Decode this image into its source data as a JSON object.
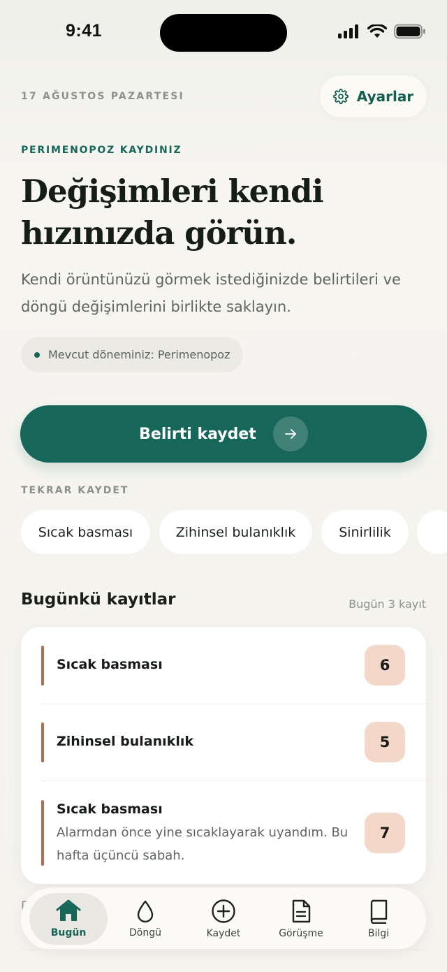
{
  "status": {
    "time": "9:41"
  },
  "header": {
    "date": "17 AĞUSTOS PAZARTESI",
    "settings_label": "Ayarlar",
    "settings_icon": "gear-icon"
  },
  "hero": {
    "eyebrow": "PERIMENOPOZ KAYDINIZ",
    "title_line1": "Değişimleri kendi",
    "title_line2": "hızınızda görün.",
    "subtext": "Kendi örüntünüzü görmek istediğinizde belirtileri ve döngü değişimlerini birlikte saklayın.",
    "phase_chip": "Mevcut döneminiz: Perimenopoz"
  },
  "cta": {
    "label": "Belirti kaydet",
    "icon": "arrow-right-icon"
  },
  "quick": {
    "label": "TEKRAR KAYDET",
    "chips": [
      "Sıcak basması",
      "Zihinsel bulanıklık",
      "Sinirlilik"
    ]
  },
  "today": {
    "title": "Bugünkü kayıtlar",
    "meta": "Bugün 3 kayıt",
    "entries": [
      {
        "title": "Sıcak basması",
        "score": "6",
        "note": ""
      },
      {
        "title": "Zihinsel bulanıklık",
        "score": "5",
        "note": ""
      },
      {
        "title": "Sıcak basması",
        "score": "7",
        "note": "Alarmdan önce yine sıcaklayarak uyandım. Bu hafta üçüncü sabah."
      }
    ]
  },
  "colors": {
    "primary": "#166759",
    "accent_bar": "#b46d4e",
    "score_bg": "#f3d8c9",
    "background": "#f5f3ee"
  },
  "tabbar": {
    "tabs": [
      {
        "label": "Bugün",
        "icon": "home-icon",
        "active": true
      },
      {
        "label": "Döngü",
        "icon": "drop-icon",
        "active": false
      },
      {
        "label": "Kaydet",
        "icon": "plus-circle-icon",
        "active": false
      },
      {
        "label": "Görüşme",
        "icon": "document-icon",
        "active": false
      },
      {
        "label": "Bilgi",
        "icon": "book-icon",
        "active": false
      }
    ]
  }
}
